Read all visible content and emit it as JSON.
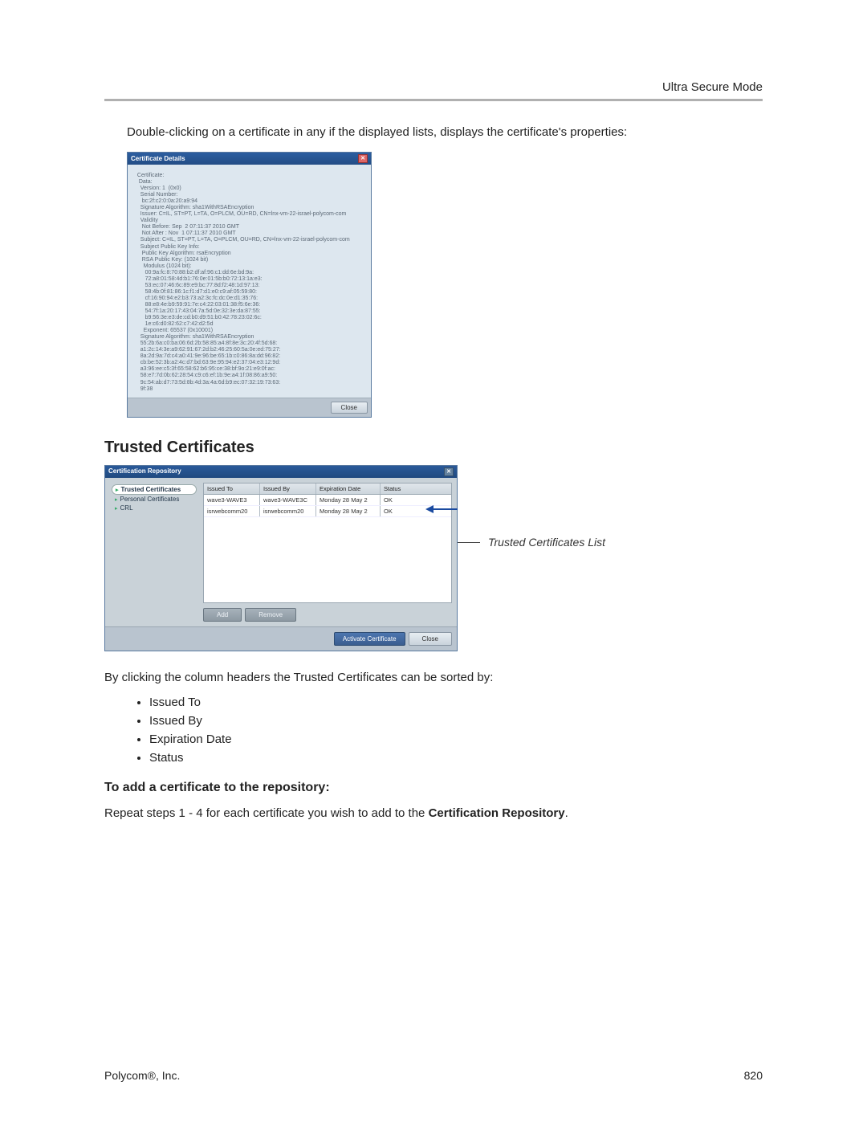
{
  "header": {
    "right": "Ultra Secure Mode"
  },
  "intro": "Double-clicking on a certificate in any if the displayed lists, displays the certificate's properties:",
  "cert_details": {
    "title": "Certificate Details",
    "body": "  Certificate:\n   Data:\n    Version: 1  (0x0)\n    Serial Number:\n     bc:2f:c2:0:0a:20:a9:94\n    Signature Algorithm: sha1WithRSAEncryption\n    Issuer: C=IL, ST=PT, L=TA, O=PLCM, OU=RD, CN=lnx-vm-22-israel-polycom-com\n    Validity\n     Not Before: Sep  2 07:11:37 2010 GMT\n     Not After : Nov  1 07:11:37 2010 GMT\n    Subject: C=IL, ST=PT, L=TA, O=PLCM, OU=RD, CN=lnx-vm-22-israel-polycom-com\n    Subject Public Key Info:\n     Public Key Algorithm: rsaEncryption\n     RSA Public Key: (1024 bit)\n      Modulus (1024 bit):\n       00:9a:fc:8:70:88:b2:df:af:96:c1:dd:6e:bd:9a:\n       72:a8:01:58:4d:b1:76:0e:01:5b:b0:72:13:1a:e3:\n       53:ec:07:46:6c:89:e9:bc:77:8d:f2:48:1d:97:13:\n       58:4b:0f:81:86:1c:f1:d7:d1:e0:c9:af:05:59:80:\n       cf:16:90:94:e2:b3:73:a2:3c:fc:dc:0e:d1:35:76:\n       88:e8:4e:b9:59:91:7e:c4:22:03:01:38:f5:6e:36:\n       54:7f:1a:20:17:43:04:7a:5d:0e:32:3e:da:87:55:\n       b9:56:3e:e3:de:cd:b0:d9:51:b0:42:78:23:02:6c:\n       1e:c6:d0:82:62:c7:42:d2:5d\n      Exponent: 65537 (0x10001)\n    Signature Algorithm: sha1WithRSAEncryption\n    55:2b:6a:c0:ba:06:6d:2b:58:85:a4:8f:8e:3c:20:4f:5d:68:\n    a1:2c:14:3e:a9:62:91:67:2d:b2:46:25:60:5a:0e:ed:75:27:\n    8a:2d:9a:7d:c4:a0:41:9e:96:be:65:1b:c0:86:8a:dd:96:82:\n    cb:be:52:3b:a2:4c:d7:bd:63:9e:95:94:e2:37:04:e3:12:9d:\n    a3:96:ee:c5:3f:65:58:62:b6:95:ce:38:bf:9o:21:e9:0f:ac:\n    58:e7:7d:0b:62:28:54:c9:c6:ef:1b:9e:a4:1f:08:86:a9:50:\n    9c:54:ab:d7:73:5d:8b:4d:3a:4a:6d:b9:ec:07:32:19:73:63:\n    9f:38",
    "close": "Close"
  },
  "section_title": "Trusted Certificates",
  "repo": {
    "title": "Certification Repository",
    "tree": {
      "trusted": "Trusted Certificates",
      "personal": "Personal Certificates",
      "crl": "CRL"
    },
    "columns": {
      "c1": "Issued To",
      "c2": "Issued By",
      "c3": "Expiration Date",
      "c4": "Status"
    },
    "rows": [
      {
        "c1": "wave3-WAVE3",
        "c2": "wave3-WAVE3C",
        "c3": "Monday 28 May 2",
        "c4": "OK"
      },
      {
        "c1": "isrwebcomm20",
        "c2": "isrwebcomm20",
        "c3": "Monday 28 May 2",
        "c4": "OK"
      }
    ],
    "add": "Add",
    "remove": "Remove",
    "activate": "Activate Certificate",
    "close": "Close"
  },
  "callout": "Trusted Certificates List",
  "sort_intro": "By clicking the column headers the Trusted Certificates can be sorted by:",
  "bullets": [
    "Issued To",
    "Issued By",
    "Expiration Date",
    "Status"
  ],
  "add_heading": "To add a certificate to the repository:",
  "add_text_pre": "Repeat steps 1 - 4 for each certificate you wish to add to the ",
  "add_text_bold": "Certification Repository",
  "add_text_post": ".",
  "footer": {
    "left": "Polycom®, Inc.",
    "right": "820"
  }
}
